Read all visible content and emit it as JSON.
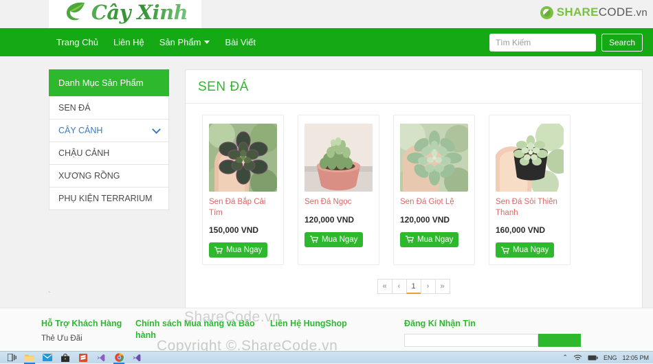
{
  "header": {
    "logo_text": "Cây Xinh",
    "sharecode": {
      "share": "SHARE",
      "code": "CODE",
      "vn": ".vn"
    }
  },
  "nav": {
    "items": [
      {
        "label": "Trang Chủ",
        "has_caret": false
      },
      {
        "label": "Liên Hệ",
        "has_caret": false
      },
      {
        "label": "Sản Phẩm",
        "has_caret": true
      },
      {
        "label": "Bài Viết",
        "has_caret": false
      }
    ],
    "search": {
      "placeholder": "Tìm Kiếm",
      "value": "",
      "button_label": "Search"
    }
  },
  "sidebar": {
    "heading": "Danh Mục Sản Phẩm",
    "items": [
      {
        "label": "SEN ĐÁ",
        "active": false,
        "chevron": false
      },
      {
        "label": "CÂY CẢNH",
        "active": true,
        "chevron": true
      },
      {
        "label": "CHẬU CẢNH",
        "active": false,
        "chevron": false
      },
      {
        "label": "XƯƠNG RỒNG",
        "active": false,
        "chevron": false
      },
      {
        "label": "PHỤ KIỆN TERRARIUM",
        "active": false,
        "chevron": false
      }
    ]
  },
  "main": {
    "title": "SEN ĐÁ",
    "products": [
      {
        "name": "Sen Đá Bắp Cải Tím",
        "price": "150,000 VND",
        "buy_label": "Mua Ngay",
        "image_alt": "hand-holding-purple-succulent"
      },
      {
        "name": "Sen Đá Ngọc",
        "price": "120,000 VND",
        "buy_label": "Mua Ngay",
        "image_alt": "green-succulent-in-pink-pot"
      },
      {
        "name": "Sen Đá Giọt Lệ",
        "price": "120,000 VND",
        "buy_label": "Mua Ngay",
        "image_alt": "mint-green-succulent"
      },
      {
        "name": "Sen Đá Sỏi Thiên Thanh",
        "price": "160,000 VND",
        "buy_label": "Mua Ngay",
        "image_alt": "pale-succulent-in-black-pot"
      }
    ],
    "pagination": {
      "first": "«",
      "prev": "‹",
      "current": "1",
      "next": "›",
      "last": "»"
    },
    "stray_mark": "`"
  },
  "footer": {
    "col1": {
      "heading": "Hỗ Trợ Khách Hàng",
      "sub": "Thẻ Ưu Đãi"
    },
    "col2": {
      "heading": "Chính sách Mua hàng và Bảo hành"
    },
    "col3": {
      "heading": "Liên Hệ HungShop"
    },
    "col4": {
      "heading": "Đăng Kí Nhận Tin",
      "input_value": "",
      "button_label": ""
    }
  },
  "watermarks": {
    "wm1": "ShareCode.vn",
    "wm2": "Copyright ©.ShareCode.vn"
  },
  "taskbar": {
    "icons": [
      {
        "name": "task-view-icon",
        "glyph": "❐",
        "active": false
      },
      {
        "name": "file-explorer-icon",
        "glyph": "🗀",
        "active": true
      },
      {
        "name": "mail-icon",
        "glyph": "✉",
        "active": false
      },
      {
        "name": "store-icon",
        "glyph": "🛍",
        "active": false
      },
      {
        "name": "sublime-text-icon",
        "glyph": "S",
        "active": false
      },
      {
        "name": "vscode-icon",
        "glyph": "✄",
        "active": false
      },
      {
        "name": "chrome-icon",
        "glyph": "◉",
        "active": true
      },
      {
        "name": "vscode-insiders-icon",
        "glyph": "✄",
        "active": false
      }
    ],
    "tray": {
      "overflow": "⌃",
      "network": "wifi-icon",
      "battery": "battery-icon",
      "language": "ENG",
      "clock": "12:05 PM"
    }
  },
  "colors": {
    "nav_green": "#16a916",
    "brand_green": "#2eb82e",
    "product_name": "#e06464",
    "link_blue": "#3a7bbf",
    "pager_accent": "#f0a030"
  }
}
